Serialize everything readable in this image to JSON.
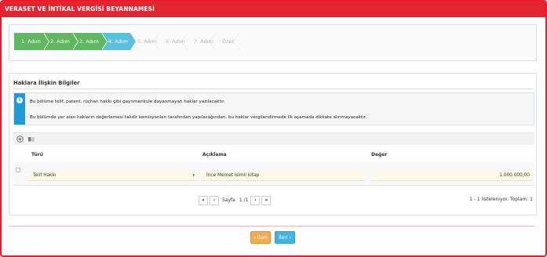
{
  "window": {
    "title": "VERASET VE İNTİKAL VERGİSİ BEYANNAMESİ"
  },
  "wizard": {
    "steps": [
      {
        "label": "1. Adım",
        "state": "done"
      },
      {
        "label": "2. Adım",
        "state": "done"
      },
      {
        "label": "3. Adım",
        "state": "done"
      },
      {
        "label": "4. Adım",
        "state": "active"
      },
      {
        "label": "5. Adım",
        "state": "todo"
      },
      {
        "label": "6. Adım",
        "state": "todo"
      },
      {
        "label": "7. Adım",
        "state": "todo"
      },
      {
        "label": "Özet",
        "state": "todo"
      }
    ]
  },
  "section": {
    "title": "Haklara İlişkin Bilgiler",
    "alert": {
      "icon": "info-icon",
      "line1": "Bu bölüme telif, patent, rüçhan hakkı gibi gayrımenkule dayanmayan haklar yazılacaktır.",
      "line2": "Bu bölümde yer alan hakların değerlemesi takdir komisyonları tarafından yapılacağından, bu haklar vergilendirmede ilk aşamada dikkate alınmayacaktır."
    },
    "toolbar": {
      "add_icon": "plus-circle-icon",
      "edit_icon": "edit-list-icon"
    },
    "grid": {
      "columns": [
        "Türü",
        "Açıklama",
        "Değer"
      ],
      "rows": [
        {
          "type": "Telif Hakkı",
          "description": "İnce Memet isimli kitap",
          "value": "1.000.000,00"
        }
      ]
    },
    "pager": {
      "first": "«",
      "prev": "‹",
      "page_label": "Sayfa",
      "page_value": "1 /1",
      "next": "›",
      "last": "»",
      "summary": "1 - 1 listeleniyor. Toplam: 1"
    }
  },
  "footer": {
    "back_label": "‹ Geri",
    "next_label": "İleri ›"
  },
  "colors": {
    "brand_red": "#e2252f",
    "step_done": "#5fb860",
    "step_active": "#5bc0de",
    "info_blue": "#1f9ad6",
    "back_orange": "#f0ad4e",
    "next_blue": "#41b5e0"
  }
}
